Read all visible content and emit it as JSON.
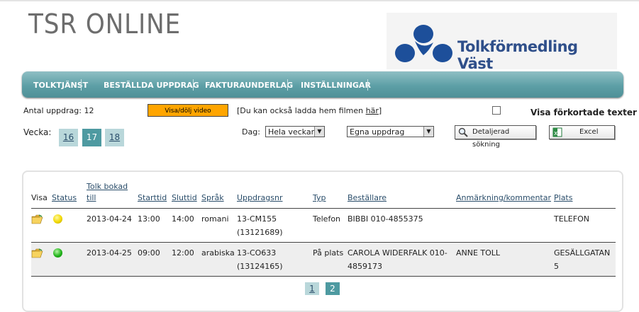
{
  "header": {
    "app_title": "TSR ONLINE",
    "logo_text": "Tolkförmedling Väst",
    "colors": {
      "logo_blue": "#1d4f9a",
      "nav_teal": "#5d9fa6"
    }
  },
  "nav": {
    "items": [
      {
        "label": "TOLKTJÄNST"
      },
      {
        "label": "BESTÄLLDA UPPDRAG"
      },
      {
        "label": "FAKTURAUNDERLAG"
      },
      {
        "label": "INSTÄLLNINGAR"
      }
    ]
  },
  "toolbar": {
    "count_label": "Antal uppdrag: 12",
    "video_button": "Visa/dölj video",
    "download_prefix": "[Du kan också ladda hem filmen ",
    "download_link": "här",
    "download_suffix": "]",
    "short_texts_label": "Visa förkortade texter",
    "week_label": "Vecka:",
    "weeks": [
      "16",
      "17",
      "18"
    ],
    "selected_week": "17",
    "day_label": "Dag:",
    "day_select": "Hela veckan",
    "scope_select": "Egna uppdrag",
    "detailed_search": "Detaljerad sökning",
    "excel": "Excel",
    "colors": {
      "video_button": "#ffa500",
      "week_selected": "#4e9aa1",
      "week_other": "#b9d7da"
    }
  },
  "table": {
    "headers": [
      "Visa",
      "Status",
      "Tolk bokad till",
      "Starttid",
      "Sluttid",
      "Språk",
      "Uppdragsnr",
      "Typ",
      "Beställare",
      "Anmärkning/kommentar",
      "Plats"
    ],
    "rows": [
      {
        "status_icon": "status-yellow-icon",
        "date": "2013-04-24",
        "start": "13:00",
        "end": "14:00",
        "language": "romani",
        "order_no": "13-CM155",
        "order_sub": "(13121689)",
        "type": "Telefon",
        "customer": "BIBBI 010-4855375",
        "comment": "",
        "place": "TELEFON"
      },
      {
        "status_icon": "status-green-icon",
        "date": "2013-04-25",
        "start": "09:00",
        "end": "12:00",
        "language": "arabiska",
        "order_no": "13-CO633",
        "order_sub": "(13124165)",
        "type": "På plats",
        "customer": "CAROLA WIDERFALK 010-4859173",
        "comment": "ANNE TOLL",
        "place": "GESÄLLGATAN 5"
      }
    ]
  },
  "pagination": {
    "pages": [
      "1",
      "2"
    ],
    "current": "2"
  }
}
